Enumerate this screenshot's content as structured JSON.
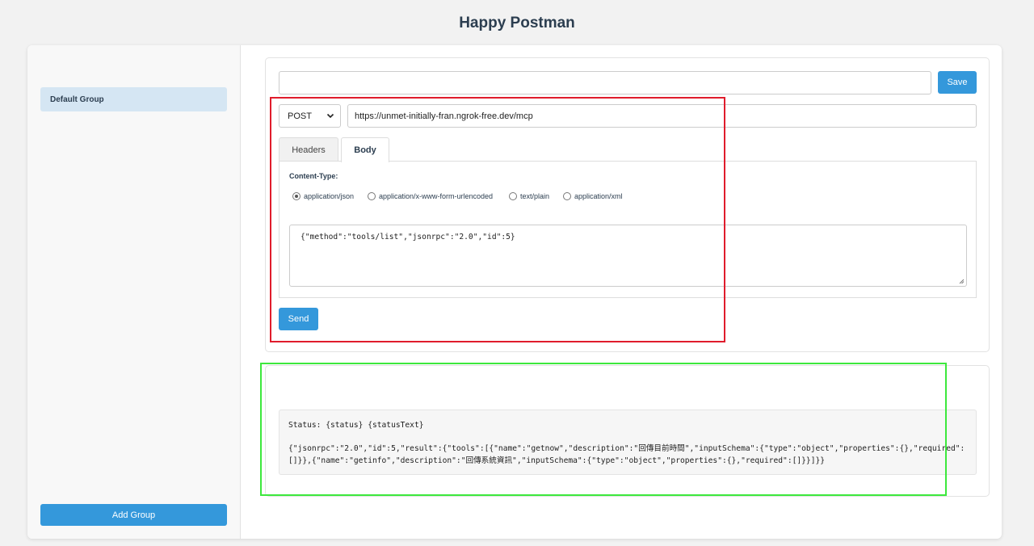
{
  "app": {
    "title": "Happy Postman"
  },
  "sidebar": {
    "groups": [
      {
        "label": "Default Group"
      }
    ],
    "add_group_label": "Add Group"
  },
  "request": {
    "name_value": "",
    "save_label": "Save",
    "method": "POST",
    "url": "https://unmet-initially-fran.ngrok-free.dev/mcp",
    "tabs": [
      {
        "label": "Headers"
      },
      {
        "label": "Body",
        "active": true
      }
    ],
    "content_type_label": "Content-Type:",
    "content_types": [
      {
        "label": "application/json",
        "checked": true
      },
      {
        "label": "application/x-www-form-urlencoded",
        "checked": false
      },
      {
        "label": "text/plain",
        "checked": false
      },
      {
        "label": "application/xml",
        "checked": false
      }
    ],
    "body_value": "{\"method\":\"tools/list\",\"jsonrpc\":\"2.0\",\"id\":5}",
    "send_label": "Send"
  },
  "response": {
    "status_line": "Status: {status} {statusText}",
    "body": "{\"jsonrpc\":\"2.0\",\"id\":5,\"result\":{\"tools\":[{\"name\":\"getnow\",\"description\":\"回傳目前時間\",\"inputSchema\":{\"type\":\"object\",\"properties\":{},\"required\":[]}},{\"name\":\"getinfo\",\"description\":\"回傳系統資訊\",\"inputSchema\":{\"type\":\"object\",\"properties\":{},\"required\":[]}}]}}"
  },
  "colors": {
    "accent": "#3498db",
    "group_selected": "#d5e6f3",
    "highlight_request": "#e01c2c",
    "highlight_response": "#3de83d"
  },
  "icons": {
    "method_dropdown": "chevron-down-icon",
    "textarea_resize": "resize-grip-icon"
  }
}
